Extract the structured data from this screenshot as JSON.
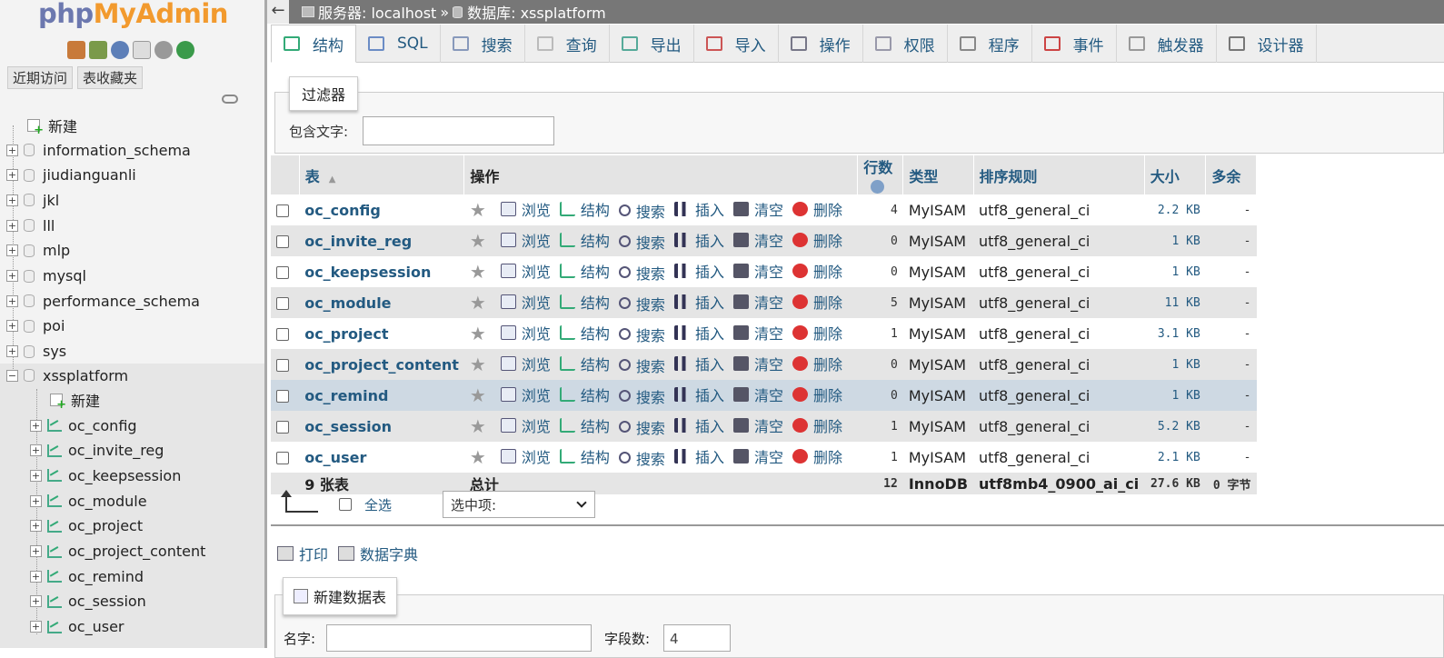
{
  "logo": {
    "php": "php",
    "myadmin": "MyAdmin"
  },
  "left_nav": {
    "recent_tab": "近期访问",
    "favorites_tab": "表收藏夹",
    "new_label": "新建",
    "databases": [
      "information_schema",
      "jiudianguanli",
      "jkl",
      "lll",
      "mlp",
      "mysql",
      "performance_schema",
      "poi",
      "sys"
    ],
    "expanded_db": "xssplatform",
    "expanded_new": "新建",
    "expanded_tables": [
      "oc_config",
      "oc_invite_reg",
      "oc_keepsession",
      "oc_module",
      "oc_project",
      "oc_project_content",
      "oc_remind",
      "oc_session",
      "oc_user"
    ]
  },
  "breadcrumb": {
    "server_label": "服务器: localhost",
    "separator": "»",
    "db_label": "数据库: xssplatform"
  },
  "tabs": [
    {
      "label": "结构",
      "icon": "structure-icon",
      "color": "#3a7"
    },
    {
      "label": "SQL",
      "icon": "sql-icon",
      "color": "#6b8cc5"
    },
    {
      "label": "搜索",
      "icon": "search-icon",
      "color": "#8899bb"
    },
    {
      "label": "查询",
      "icon": "query-icon",
      "color": "#bbb"
    },
    {
      "label": "导出",
      "icon": "export-icon",
      "color": "#5a9"
    },
    {
      "label": "导入",
      "icon": "import-icon",
      "color": "#c55"
    },
    {
      "label": "操作",
      "icon": "wrench-icon",
      "color": "#778"
    },
    {
      "label": "权限",
      "icon": "privileges-icon",
      "color": "#99a"
    },
    {
      "label": "程序",
      "icon": "routines-icon",
      "color": "#888"
    },
    {
      "label": "事件",
      "icon": "clock-icon",
      "color": "#c44"
    },
    {
      "label": "触发器",
      "icon": "triggers-icon",
      "color": "#999"
    },
    {
      "label": "设计器",
      "icon": "designer-icon",
      "color": "#777"
    }
  ],
  "filter": {
    "legend": "过滤器",
    "label": "包含文字:",
    "value": ""
  },
  "table_headers": {
    "table": "表",
    "actions": "操作",
    "rows": "行数",
    "type": "类型",
    "collation": "排序规则",
    "size": "大小",
    "overhead": "多余"
  },
  "action_labels": {
    "browse": "浏览",
    "structure": "结构",
    "search": "搜索",
    "insert": "插入",
    "empty": "清空",
    "drop": "删除"
  },
  "tables": [
    {
      "name": "oc_config",
      "rows": "4",
      "type": "MyISAM",
      "collation": "utf8_general_ci",
      "size": "2.2 KB",
      "overhead": "-"
    },
    {
      "name": "oc_invite_reg",
      "rows": "0",
      "type": "MyISAM",
      "collation": "utf8_general_ci",
      "size": "1 KB",
      "overhead": "-"
    },
    {
      "name": "oc_keepsession",
      "rows": "0",
      "type": "MyISAM",
      "collation": "utf8_general_ci",
      "size": "1 KB",
      "overhead": "-"
    },
    {
      "name": "oc_module",
      "rows": "5",
      "type": "MyISAM",
      "collation": "utf8_general_ci",
      "size": "11 KB",
      "overhead": "-"
    },
    {
      "name": "oc_project",
      "rows": "1",
      "type": "MyISAM",
      "collation": "utf8_general_ci",
      "size": "3.1 KB",
      "overhead": "-"
    },
    {
      "name": "oc_project_content",
      "rows": "0",
      "type": "MyISAM",
      "collation": "utf8_general_ci",
      "size": "1 KB",
      "overhead": "-"
    },
    {
      "name": "oc_remind",
      "rows": "0",
      "type": "MyISAM",
      "collation": "utf8_general_ci",
      "size": "1 KB",
      "overhead": "-"
    },
    {
      "name": "oc_session",
      "rows": "1",
      "type": "MyISAM",
      "collation": "utf8_general_ci",
      "size": "5.2 KB",
      "overhead": "-"
    },
    {
      "name": "oc_user",
      "rows": "1",
      "type": "MyISAM",
      "collation": "utf8_general_ci",
      "size": "2.1 KB",
      "overhead": "-"
    }
  ],
  "footer": {
    "count": "9 张表",
    "total_label": "总计",
    "rows": "12",
    "type": "InnoDB",
    "collation": "utf8mb4_0900_ai_ci",
    "size": "27.6 KB",
    "overhead": "0 字节"
  },
  "bulk": {
    "select_all": "全选",
    "select_placeholder": "选中项:"
  },
  "links": {
    "print": "打印",
    "dictionary": "数据字典"
  },
  "new_table": {
    "legend": "新建数据表",
    "name_label": "名字:",
    "cols_label": "字段数:",
    "cols_value": "4"
  }
}
